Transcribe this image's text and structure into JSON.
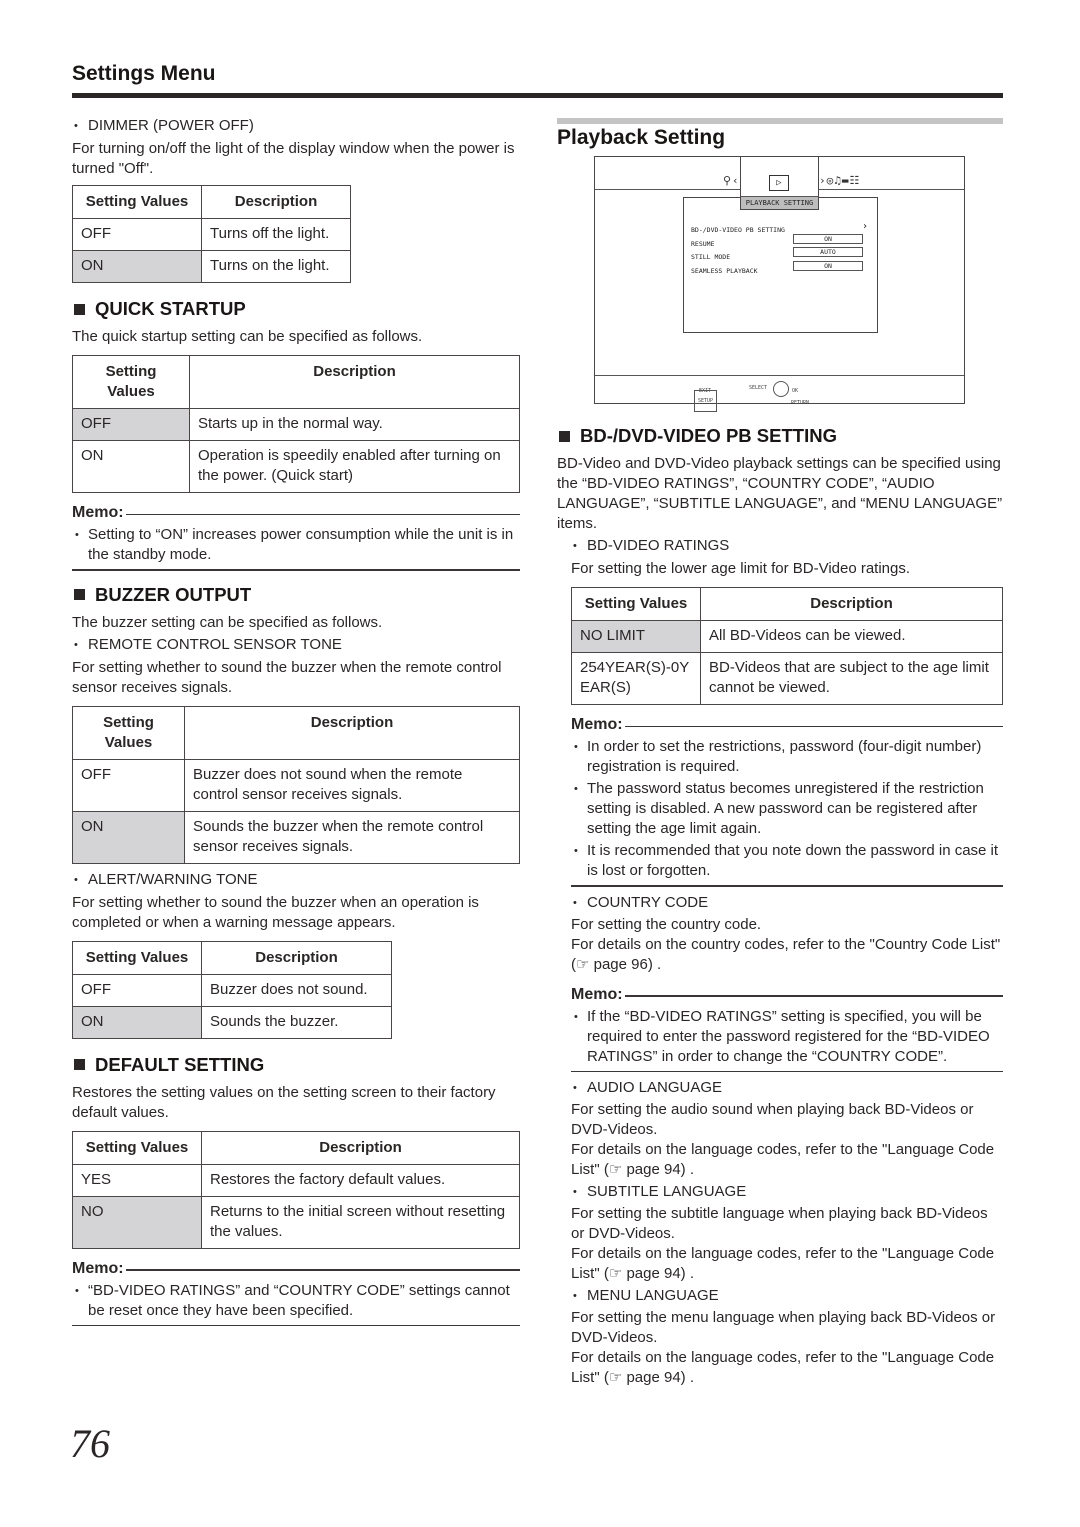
{
  "header": {
    "title": "Settings Menu"
  },
  "left": {
    "dimmer": {
      "label": "DIMMER (POWER OFF)",
      "desc": "For turning on/off the light of the display window when the power is turned \"Off\".",
      "table": {
        "headers": [
          "Setting Values",
          "Description"
        ],
        "rows": [
          {
            "value": "OFF",
            "desc": "Turns off the light.",
            "default": false
          },
          {
            "value": "ON",
            "desc": "Turns on the light.",
            "default": true
          }
        ]
      }
    },
    "quick_startup": {
      "title": "QUICK STARTUP",
      "desc": "The quick startup setting can be specified as follows.",
      "table": {
        "headers": [
          "Setting Values",
          "Description"
        ],
        "rows": [
          {
            "value": "OFF",
            "desc": "Starts up in the normal way.",
            "default": true
          },
          {
            "value": "ON",
            "desc": "Operation is speedily enabled after turning on the power. (Quick start)",
            "default": false
          }
        ]
      },
      "memo": {
        "label": "Memo:",
        "items": [
          "Setting to “ON” increases power consumption while the unit is in the standby mode."
        ]
      }
    },
    "buzzer_output": {
      "title": "BUZZER OUTPUT",
      "desc": "The buzzer setting can be specified as follows.",
      "remote": {
        "label": "REMOTE CONTROL SENSOR TONE",
        "desc": "For setting whether to sound the buzzer when the remote control sensor receives signals.",
        "table": {
          "headers": [
            "Setting Values",
            "Description"
          ],
          "rows": [
            {
              "value": "OFF",
              "desc": "Buzzer does not sound when the remote control sensor receives signals.",
              "default": false
            },
            {
              "value": "ON",
              "desc": "Sounds the buzzer when the remote control sensor receives signals.",
              "default": true
            }
          ]
        }
      },
      "alert": {
        "label": "ALERT/WARNING TONE",
        "desc": "For setting whether to sound the buzzer when an operation is completed or when a warning message appears.",
        "table": {
          "headers": [
            "Setting Values",
            "Description"
          ],
          "rows": [
            {
              "value": "OFF",
              "desc": "Buzzer does not sound.",
              "default": false
            },
            {
              "value": "ON",
              "desc": "Sounds the buzzer.",
              "default": true
            }
          ]
        }
      }
    },
    "default_setting": {
      "title": "DEFAULT SETTING",
      "desc": "Restores the setting values on the setting screen to their factory default values.",
      "table": {
        "headers": [
          "Setting Values",
          "Description"
        ],
        "rows": [
          {
            "value": "YES",
            "desc": "Restores the factory default values.",
            "default": false
          },
          {
            "value": "NO",
            "desc": "Returns to the initial screen without resetting the values.",
            "default": true
          }
        ]
      },
      "memo": {
        "label": "Memo:",
        "items": [
          "“BD-VIDEO RATINGS” and “COUNTRY CODE” settings cannot be reset once they have been specified."
        ]
      }
    }
  },
  "right": {
    "title": "Playback Setting",
    "screen": {
      "tab_label": "PLAYBACK SETTING",
      "play_glyph": "▷",
      "left_icons": "⚲‹",
      "right_icons": "›◎♫▬☷",
      "rows": [
        {
          "label": "BD-/DVD-VIDEO PB SETTING",
          "value": null,
          "arrow": "›"
        },
        {
          "label": "RESUME",
          "value": "ON"
        },
        {
          "label": "STILL MODE",
          "value": "AUTO"
        },
        {
          "label": "SEAMLESS PLAYBACK",
          "value": "ON"
        }
      ],
      "footer": {
        "exit": "EXIT",
        "setup": "SETUP",
        "select": "SELECT",
        "ok": "OK",
        "return": "RETURN"
      }
    },
    "bd_dvd": {
      "title": "BD-/DVD-VIDEO PB SETTING",
      "desc": "BD-Video and DVD-Video playback settings can be specified using the “BD-VIDEO RATINGS”, “COUNTRY CODE”, “AUDIO LANGUAGE”, “SUBTITLE LANGUAGE”, and “MENU LANGUAGE” items.",
      "ratings": {
        "label": "BD-VIDEO RATINGS",
        "desc": "For setting the lower age limit for BD-Video ratings.",
        "table": {
          "headers": [
            "Setting Values",
            "Description"
          ],
          "rows": [
            {
              "value": "NO LIMIT",
              "desc": "All BD-Videos can be viewed.",
              "default": true
            },
            {
              "value": "254YEAR(S)-0YEAR(S)",
              "desc": "BD-Videos that are subject to the age limit cannot be viewed.",
              "default": false
            }
          ]
        },
        "memo": {
          "label": "Memo:",
          "items": [
            "In order to set the restrictions, password (four-digit number) registration is required.",
            "The password status becomes unregistered if the restriction setting is disabled. A new password can be registered after setting the age limit again.",
            "It is recommended that you note down the password in case it is lost or forgotten."
          ]
        }
      },
      "country": {
        "label": "COUNTRY CODE",
        "desc1": "For setting the country code.",
        "desc2": "For details on the country codes, refer to the \"Country Code List\" (☞ page 96) .",
        "memo": {
          "label": "Memo:",
          "items": [
            "If the “BD-VIDEO RATINGS” setting is specified, you will be required to enter the password registered for the “BD-VIDEO RATINGS” in order to change the “COUNTRY CODE”."
          ]
        }
      },
      "audio": {
        "label": "AUDIO LANGUAGE",
        "desc1": "For setting the audio sound when playing back BD-Videos or DVD-Videos.",
        "desc2": "For details on the language codes, refer to the \"Language Code List\" (☞ page 94) ."
      },
      "subtitle": {
        "label": "SUBTITLE LANGUAGE",
        "desc1": "For setting the subtitle language when playing back BD-Videos or DVD-Videos.",
        "desc2": "For details on the language codes, refer to the \"Language Code List\" (☞ page 94) ."
      },
      "menu": {
        "label": "MENU LANGUAGE",
        "desc1": "For setting the menu language when playing back BD-Videos or DVD-Videos.",
        "desc2": "For details on the language codes, refer to the \"Language Code List\" (☞ page 94) ."
      }
    }
  },
  "page_number": "76",
  "colors": {
    "shaded_cell": "#d4d4d6",
    "text": "#2a2626",
    "rule": "#2a2626",
    "section_rule": "#c4c4c4"
  }
}
